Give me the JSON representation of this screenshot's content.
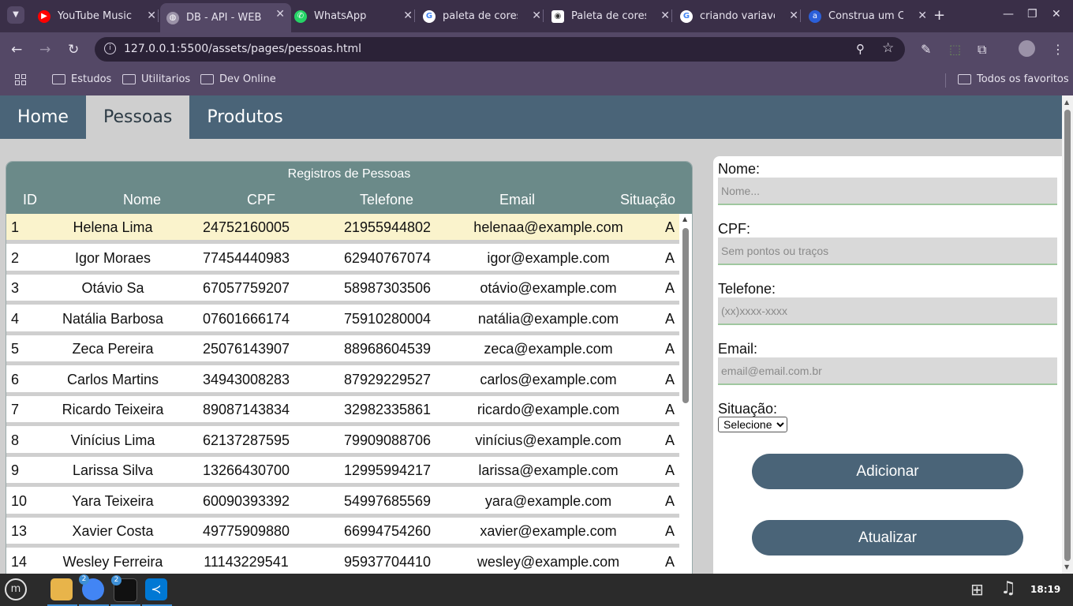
{
  "browser": {
    "tabs": [
      {
        "title": "YouTube Music",
        "icon": "youtube-music-icon",
        "color": "#ff0000"
      },
      {
        "title": "DB - API - WEB",
        "icon": "globe-icon",
        "color": "#9b92a8"
      },
      {
        "title": "WhatsApp",
        "icon": "whatsapp-icon",
        "color": "#25d366"
      },
      {
        "title": "paleta de cores",
        "icon": "google-icon",
        "color": "#ffffff"
      },
      {
        "title": "Paleta de cores",
        "icon": "palette-site-icon",
        "color": "#ffffff"
      },
      {
        "title": "criando variavei",
        "icon": "google-icon",
        "color": "#ffffff"
      },
      {
        "title": "Construa um CS",
        "icon": "site-a-icon",
        "color": "#2b5fd9"
      }
    ],
    "url": "127.0.0.1:5500/assets/pages/pessoas.html",
    "bookmarks": [
      "Estudos",
      "Utilitarios",
      "Dev Online"
    ],
    "all_bookmarks": "Todos os favoritos"
  },
  "nav": {
    "items": [
      "Home",
      "Pessoas",
      "Produtos"
    ],
    "active": "Pessoas"
  },
  "table": {
    "caption": "Registros de Pessoas",
    "headers": [
      "ID",
      "Nome",
      "CPF",
      "Telefone",
      "Email",
      "Situação"
    ],
    "rows": [
      {
        "id": "1",
        "nome": "Helena Lima",
        "cpf": "24752160005",
        "telefone": "21955944802",
        "email": "helenaa@example.com",
        "situacao": "A",
        "selected": true
      },
      {
        "id": "2",
        "nome": "Igor Moraes",
        "cpf": "77454440983",
        "telefone": "62940767074",
        "email": "igor@example.com",
        "situacao": "A"
      },
      {
        "id": "3",
        "nome": "Otávio Sa",
        "cpf": "67057759207",
        "telefone": "58987303506",
        "email": "otávio@example.com",
        "situacao": "A"
      },
      {
        "id": "4",
        "nome": "Natália Barbosa",
        "cpf": "07601666174",
        "telefone": "75910280004",
        "email": "natália@example.com",
        "situacao": "A"
      },
      {
        "id": "5",
        "nome": "Zeca Pereira",
        "cpf": "25076143907",
        "telefone": "88968604539",
        "email": "zeca@example.com",
        "situacao": "A"
      },
      {
        "id": "6",
        "nome": "Carlos Martins",
        "cpf": "34943008283",
        "telefone": "87929229527",
        "email": "carlos@example.com",
        "situacao": "A"
      },
      {
        "id": "7",
        "nome": "Ricardo Teixeira",
        "cpf": "89087143834",
        "telefone": "32982335861",
        "email": "ricardo@example.com",
        "situacao": "A"
      },
      {
        "id": "8",
        "nome": "Vinícius Lima",
        "cpf": "62137287595",
        "telefone": "79909088706",
        "email": "vinícius@example.com",
        "situacao": "A"
      },
      {
        "id": "9",
        "nome": "Larissa Silva",
        "cpf": "13266430700",
        "telefone": "12995994217",
        "email": "larissa@example.com",
        "situacao": "A"
      },
      {
        "id": "10",
        "nome": "Yara Teixeira",
        "cpf": "60090393392",
        "telefone": "54997685569",
        "email": "yara@example.com",
        "situacao": "A"
      },
      {
        "id": "13",
        "nome": "Xavier Costa",
        "cpf": "49775909880",
        "telefone": "66994754260",
        "email": "xavier@example.com",
        "situacao": "A"
      },
      {
        "id": "14",
        "nome": "Wesley Ferreira",
        "cpf": "11143229541",
        "telefone": "95937704410",
        "email": "wesley@example.com",
        "situacao": "A"
      }
    ]
  },
  "form": {
    "nome_label": "Nome:",
    "nome_placeholder": "Nome...",
    "cpf_label": "CPF:",
    "cpf_placeholder": "Sem pontos ou traços",
    "telefone_label": "Telefone:",
    "telefone_placeholder": "(xx)xxxx-xxxx",
    "email_label": "Email:",
    "email_placeholder": "email@email.com.br",
    "situacao_label": "Situação:",
    "situacao_selected": "Selecione",
    "add_button": "Adicionar",
    "update_button": "Atualizar"
  },
  "taskbar": {
    "clock": "18:19",
    "chrome_badge": "2",
    "terminal_badge": "2"
  },
  "colors": {
    "nav": "#4a6478",
    "table_header": "#6b8a89",
    "selected_row": "#faf3cc",
    "button": "#4a6478"
  }
}
